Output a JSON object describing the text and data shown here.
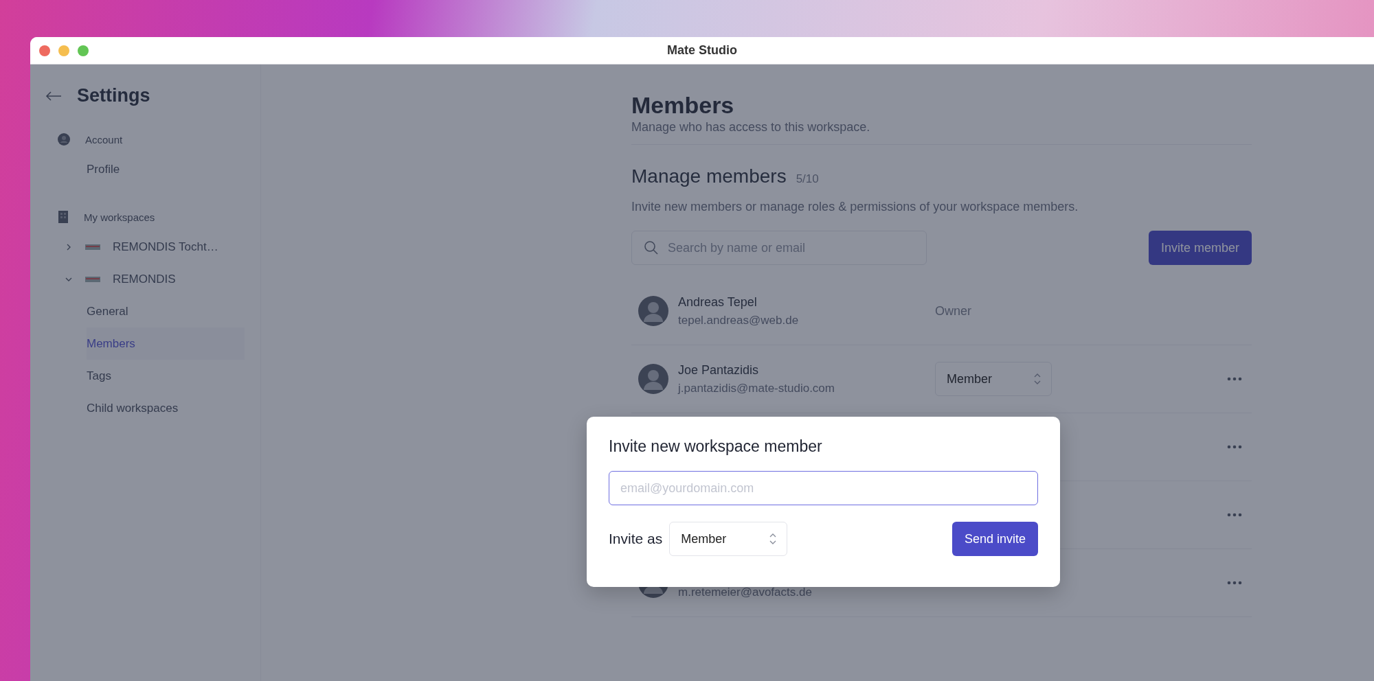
{
  "window": {
    "title": "Mate Studio"
  },
  "sidebar": {
    "title": "Settings",
    "sections": [
      {
        "kind": "account",
        "label": "Account",
        "items": [
          {
            "label": "Profile",
            "selected": false
          }
        ]
      },
      {
        "kind": "workspaces",
        "label": "My workspaces",
        "workspaces": [
          {
            "name": "REMONDIS Tocht…",
            "expanded": false
          },
          {
            "name": "REMONDIS",
            "expanded": true,
            "items": [
              {
                "label": "General",
                "selected": false
              },
              {
                "label": "Members",
                "selected": true
              },
              {
                "label": "Tags",
                "selected": false
              },
              {
                "label": "Child workspaces",
                "selected": false
              }
            ]
          }
        ]
      }
    ]
  },
  "page": {
    "title": "Members",
    "subtitle": "Manage who has access to this workspace.",
    "section_title": "Manage members",
    "count": "5/10",
    "description": "Invite new members or manage roles & permissions of your workspace members.",
    "search": {
      "placeholder": "Search by name or email"
    },
    "invite_button": "Invite member",
    "members": [
      {
        "kind": "full",
        "name": "Andreas Tepel",
        "email": "tepel.andreas@web.de",
        "role": {
          "kind": "text",
          "value": "Owner"
        },
        "menu": false
      },
      {
        "kind": "full",
        "name": "Joe Pantazidis",
        "email": "j.pantazidis@mate-studio.com",
        "role": {
          "kind": "select",
          "value": "Member"
        },
        "menu": true
      },
      {
        "kind": "hidden",
        "menu": true
      },
      {
        "kind": "hidden",
        "menu": true
      },
      {
        "kind": "partial",
        "email": "m.retemeier@avofacts.de",
        "menu": true
      }
    ]
  },
  "dialog": {
    "title": "Invite new workspace member",
    "email": {
      "placeholder": "email@yourdomain.com",
      "focused": true
    },
    "role_label": "Invite as",
    "role": "Member",
    "submit": "Send invite"
  }
}
